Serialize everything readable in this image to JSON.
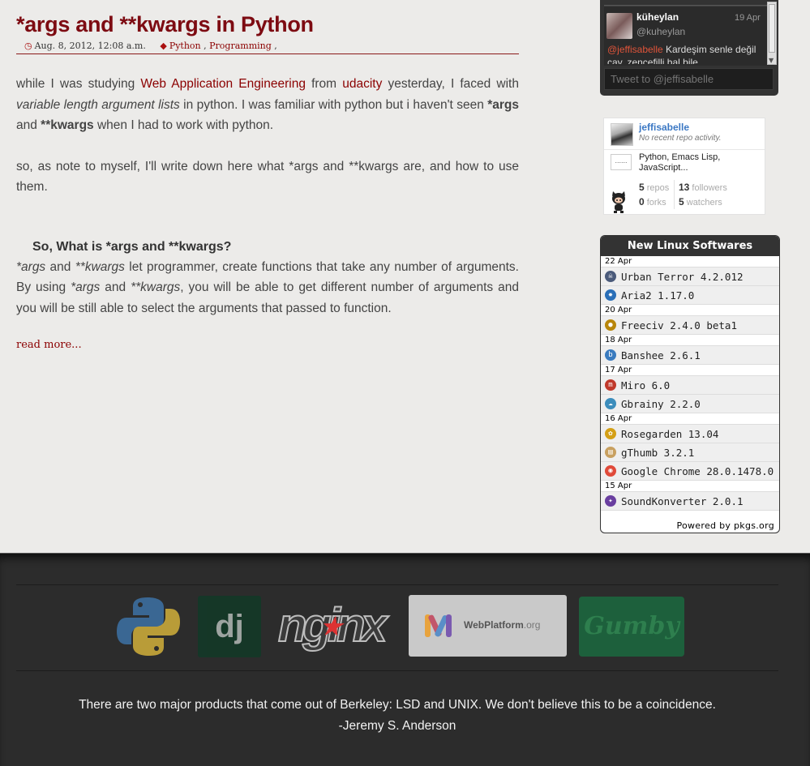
{
  "article": {
    "title": "*args and **kwargs in Python",
    "date": "Aug. 8, 2012, 12:08 a.m.",
    "tags": [
      "Python",
      "Programming"
    ],
    "p1": {
      "t1": "while I was studying ",
      "link1": "Web Application Engineering",
      "t2": " from ",
      "link2": "udacity",
      "t3": " yesterday, I faced with ",
      "em1": "variable length argument lists",
      "t4": " in python. I was familiar with python but i haven't seen ",
      "b1": "*args",
      "t5": " and ",
      "b2": "**kwargs",
      "t6": " when I had to work with python."
    },
    "p2": "so, as note to myself, I'll write down here what *args and **kwargs are, and how to use them.",
    "subheading": "So, What is *args and **kwargs?",
    "p3": {
      "em1": "*args",
      "t1": " and ",
      "em2": "**kwargs",
      "t2": " let programmer, create functions that take any number of arguments. By using ",
      "em3": "*args",
      "t3": " and ",
      "em4": "**kwargs",
      "t4": ", you will be able to get different number of arguments and you will be still able to select the arguments that passed to function."
    },
    "read_more": "read more..."
  },
  "twitter": {
    "name": "küheylan",
    "date": "19 Apr",
    "handle": "@kuheylan",
    "mention": "@jeffisabelle",
    "text": " Kardeşim senle değil çay, zencefilli bal bile",
    "input_placeholder": "Tweet to @jeffisabelle"
  },
  "github": {
    "user": "jeffisabelle",
    "note": "No recent repo activity.",
    "lang_icon": "......",
    "languages": "Python, Emacs Lisp, JavaScript...",
    "repos": "5",
    "repos_label": "repos",
    "followers": "13",
    "followers_label": "followers",
    "forks": "0",
    "forks_label": "forks",
    "watchers": "5",
    "watchers_label": "watchers"
  },
  "linux_softwares": {
    "title": "New Linux Softwares",
    "groups": [
      {
        "date": "22 Apr",
        "items": [
          {
            "name": "Urban Terror 4.2.012",
            "icon": "urban-terror-icon",
            "color": "#4a5a7a",
            "glyph": "☠"
          },
          {
            "name": "Aria2 1.17.0",
            "icon": "aria2-icon",
            "color": "#2a6fb8",
            "glyph": "✸"
          }
        ]
      },
      {
        "date": "20 Apr",
        "items": [
          {
            "name": "Freeciv 2.4.0 beta1",
            "icon": "freeciv-icon",
            "color": "#b8860b",
            "glyph": "●"
          }
        ]
      },
      {
        "date": "18 Apr",
        "items": [
          {
            "name": "Banshee 2.6.1",
            "icon": "banshee-icon",
            "color": "#3a7bbf",
            "glyph": "b"
          }
        ]
      },
      {
        "date": "17 Apr",
        "items": [
          {
            "name": "Miro 6.0",
            "icon": "miro-icon",
            "color": "#c0392b",
            "glyph": "m"
          },
          {
            "name": "Gbrainy 2.2.0",
            "icon": "gbrainy-icon",
            "color": "#3c8dbc",
            "glyph": "☁"
          }
        ]
      },
      {
        "date": "16 Apr",
        "items": [
          {
            "name": "Rosegarden 13.04",
            "icon": "rosegarden-icon",
            "color": "#d4a017",
            "glyph": "✿"
          },
          {
            "name": "gThumb 3.2.1",
            "icon": "gthumb-icon",
            "color": "#c8a060",
            "glyph": "▤"
          },
          {
            "name": "Google Chrome 28.0.1478.0",
            "icon": "chrome-icon",
            "color": "#e04a3a",
            "glyph": "◉"
          }
        ]
      },
      {
        "date": "15 Apr",
        "items": [
          {
            "name": "SoundKonverter 2.0.1",
            "icon": "soundkonverter-icon",
            "color": "#6a3fa0",
            "glyph": "✦"
          }
        ]
      }
    ],
    "powered_by": "Powered by pkgs.org"
  },
  "footer": {
    "logos": [
      "python-logo",
      "django-logo",
      "nginx-logo",
      "webplatform-logo",
      "gumby-logo"
    ],
    "django_text": "dj",
    "nginx_text": "nginx",
    "webplatform_text": "WebPlatform",
    "webplatform_suffix": ".org",
    "gumby_text": "Gumby",
    "quote": "There are two major products that come out of Berkeley: LSD and UNIX. We don't believe this to be a coincidence.",
    "author": "-Jeremy S. Anderson"
  }
}
